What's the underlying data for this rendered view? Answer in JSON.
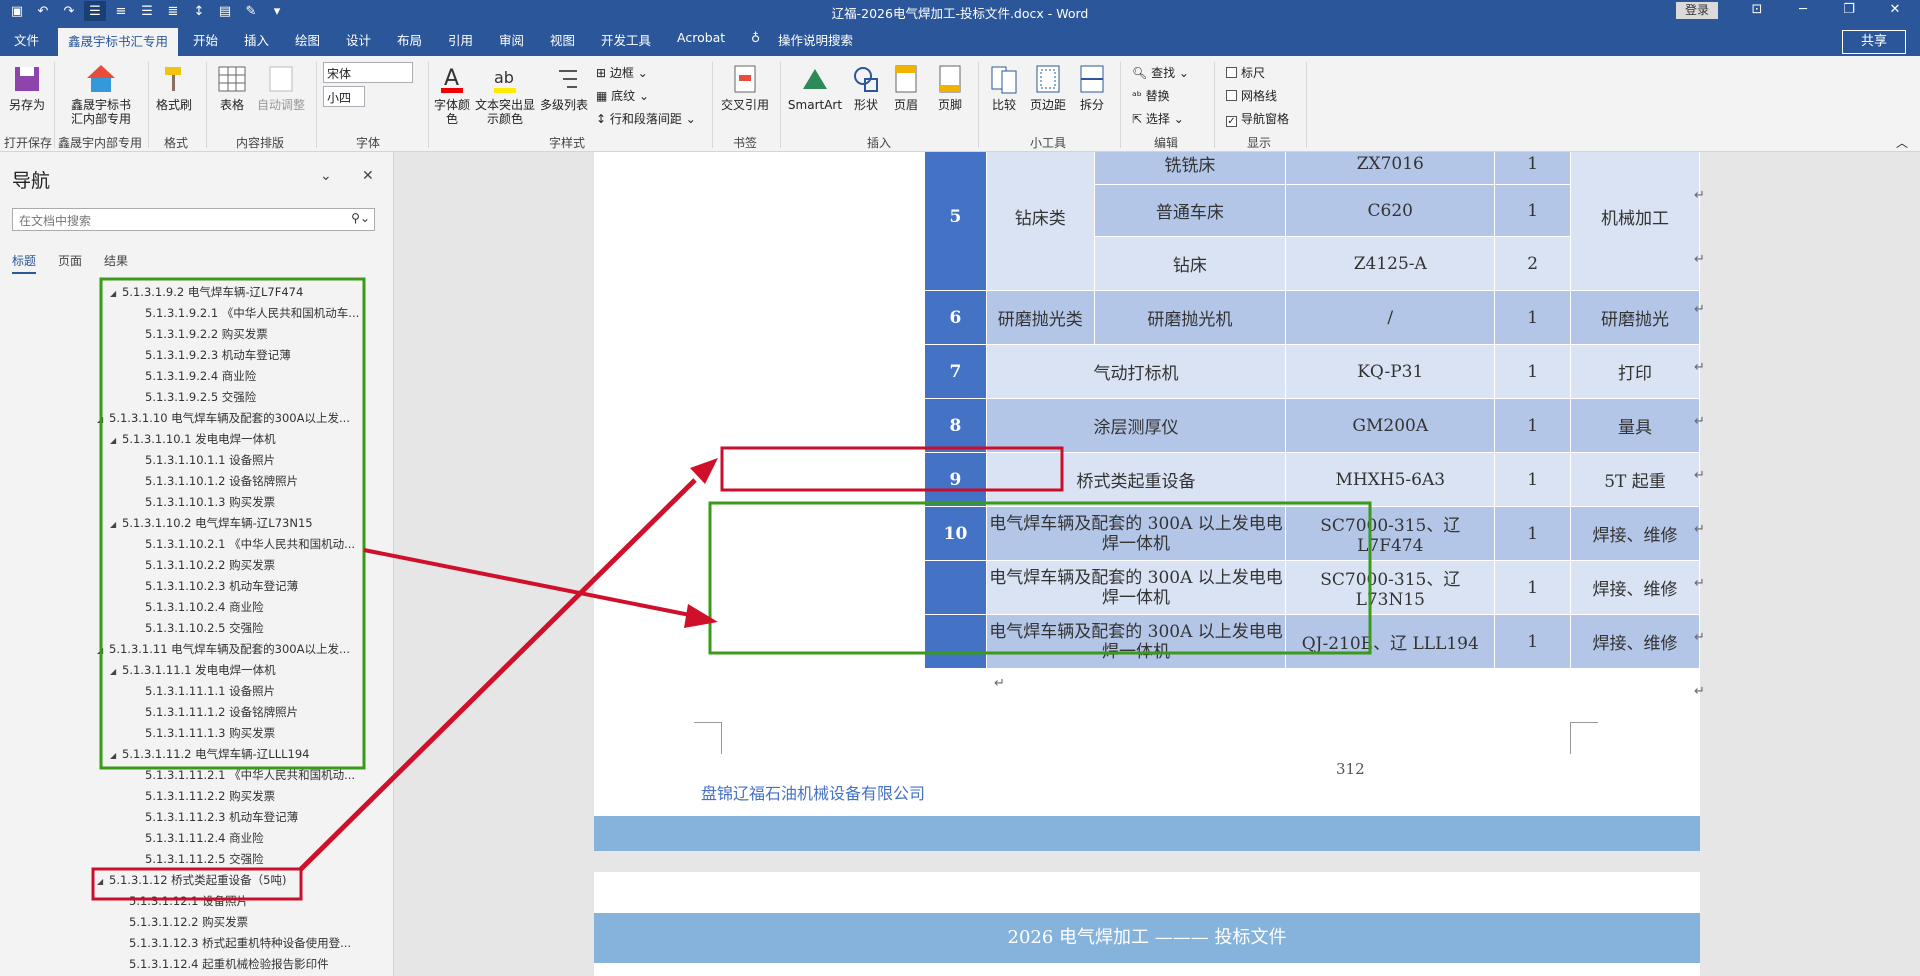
{
  "window": {
    "title": "辽福-2026电气焊加工-投标文件.docx  -  Word",
    "login": "登录"
  },
  "menu": {
    "tabs": [
      "文件",
      "鑫晟宇标书汇专用",
      "开始",
      "插入",
      "绘图",
      "设计",
      "布局",
      "引用",
      "审阅",
      "视图",
      "开发工具",
      "Acrobat"
    ],
    "tell": "操作说明搜索",
    "share": "共享"
  },
  "ribbon": {
    "saveas": "另存为",
    "xsy": "鑫晟宇标书汇内部专用",
    "painter": "格式刷",
    "table": "表格",
    "autofit": "自动调整",
    "font_name": "宋体",
    "font_size": "小四",
    "font_color": "字体颜色",
    "highlight": "文本突出显示颜色",
    "multilist": "多级列表",
    "border": "边框",
    "shading": "底纹",
    "spacing": "行和段落间距",
    "crossref": "交叉引用",
    "smartart": "SmartArt",
    "shapes": "形状",
    "header": "页眉",
    "footer": "页脚",
    "compare": "比较",
    "margins": "页边距",
    "split": "拆分",
    "find": "查找",
    "replace": "替换",
    "select": "选择",
    "ruler": "标尺",
    "grid": "网格线",
    "navpane": "导航窗格",
    "groups": {
      "g1": "打开保存",
      "g2": "鑫晟宇内部专用",
      "g3": "格式",
      "g4": "内容排版",
      "g5": "字体",
      "g6": "字样式",
      "g7": "书签",
      "g8": "插入",
      "g9": "小工具",
      "g10": "编辑",
      "g11": "显示"
    }
  },
  "nav": {
    "title": "导航",
    "search_placeholder": "在文档中搜索",
    "tabs": [
      "标题",
      "页面",
      "结果"
    ],
    "items": [
      "5.1.3.1.9.2 电气焊车辆-辽L7F474",
      "5.1.3.1.9.2.1 《中华人民共和国机动车...",
      "5.1.3.1.9.2.2 购买发票",
      "5.1.3.1.9.2.3 机动车登记薄",
      "5.1.3.1.9.2.4 商业险",
      "5.1.3.1.9.2.5 交强险",
      "5.1.3.1.10 电气焊车辆及配套的300A以上发...",
      "5.1.3.1.10.1 发电电焊一体机",
      "5.1.3.1.10.1.1 设备照片",
      "5.1.3.1.10.1.2 设备铭牌照片",
      "5.1.3.1.10.1.3 购买发票",
      "5.1.3.1.10.2 电气焊车辆-辽L73N15",
      "5.1.3.1.10.2.1 《中华人民共和国机动...",
      "5.1.3.1.10.2.2 购买发票",
      "5.1.3.1.10.2.3 机动车登记薄",
      "5.1.3.1.10.2.4 商业险",
      "5.1.3.1.10.2.5 交强险",
      "5.1.3.1.11 电气焊车辆及配套的300A以上发...",
      "5.1.3.1.11.1 发电电焊一体机",
      "5.1.3.1.11.1.1 设备照片",
      "5.1.3.1.11.1.2 设备铭牌照片",
      "5.1.3.1.11.1.3 购买发票",
      "5.1.3.1.11.2 电气焊车辆-辽LLL194",
      "5.1.3.1.11.2.1 《中华人民共和国机动...",
      "5.1.3.1.11.2.2 购买发票",
      "5.1.3.1.11.2.3 机动车登记薄",
      "5.1.3.1.11.2.4 商业险",
      "5.1.3.1.11.2.5 交强险",
      "5.1.3.1.12 桥式类起重设备（5吨)",
      "5.1.3.1.12.1 设备照片",
      "5.1.3.1.12.2 购买发票",
      "5.1.3.1.12.3 桥式起重机特种设备使用登...",
      "5.1.3.1.12.4 起重机械检验报告影印件"
    ]
  },
  "doc": {
    "rows": {
      "r5a": [
        "铣铣床",
        "ZX7016",
        "1"
      ],
      "r5": [
        "5",
        "钻床类",
        "普通车床",
        "C620",
        "1",
        "机械加工"
      ],
      "r5b": [
        "钻床",
        "Z4125-A",
        "2"
      ],
      "r6": [
        "6",
        "研磨抛光类",
        "研磨抛光机",
        "/",
        "1",
        "研磨抛光"
      ],
      "r7": [
        "7",
        "气动打标机",
        "KQ-P31",
        "1",
        "打印"
      ],
      "r8": [
        "8",
        "涂层测厚仪",
        "GM200A",
        "1",
        "量具"
      ],
      "r9": [
        "9",
        "桥式类起重设备",
        "MHXH5-6A3",
        "1",
        "5T 起重"
      ],
      "r10": [
        "10",
        "电气焊车辆及配套的 300A 以上发电电焊一体机",
        "SC7000-315、辽 L7F474",
        "1",
        "焊接、维修"
      ],
      "r11": [
        "电气焊车辆及配套的 300A 以上发电电焊一体机",
        "SC7000-315、辽 L73N15",
        "1",
        "焊接、维修"
      ],
      "r12": [
        "电气焊车辆及配套的 300A 以上发电电焊一体机",
        "QJ-210E、辽 LLL194",
        "1",
        "焊接、维修"
      ]
    },
    "page_number": "312",
    "company": "盘锦辽福石油机械设备有限公司",
    "next_header": "2026 电气焊加工 ——— 投标文件"
  },
  "colors": {
    "accent": "#2b579a",
    "table_dark": "#4472c4",
    "table_mid": "#b4c6e7",
    "table_light": "#dae3f3",
    "box_red": "#c8102e",
    "box_green": "#3a9a1a"
  }
}
